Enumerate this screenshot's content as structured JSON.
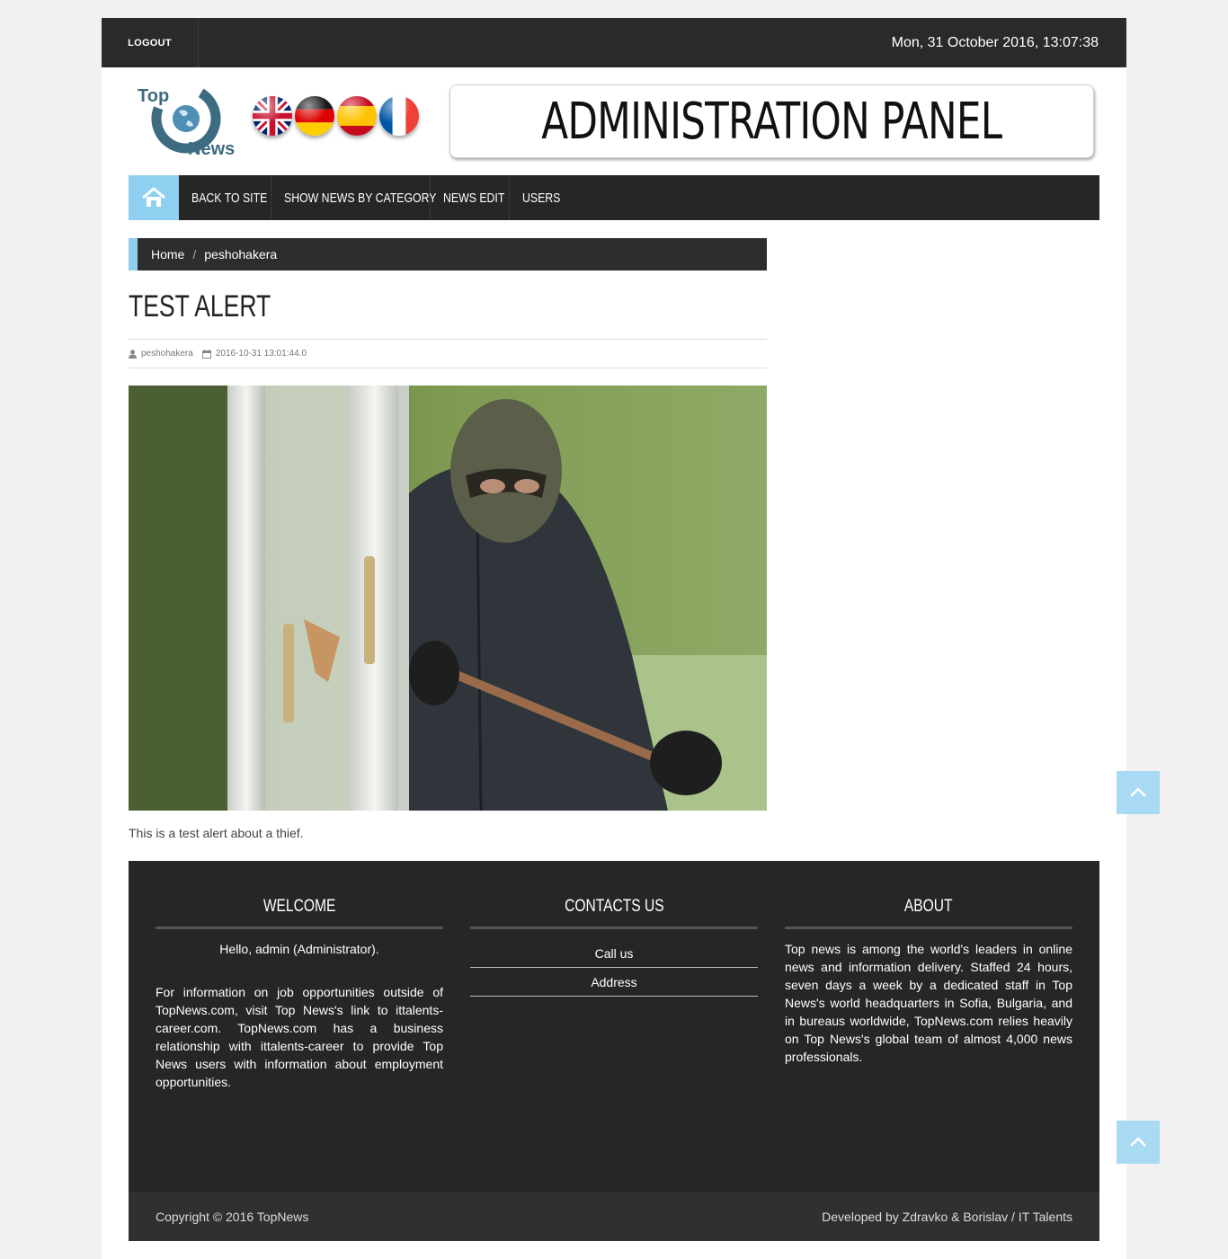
{
  "topbar": {
    "logout_label": "LOGOUT",
    "datetime": "Mon, 31 October 2016, 13:07:38"
  },
  "header": {
    "logo_text_top": "Top",
    "logo_text_bottom": "News",
    "flags": [
      "uk-flag",
      "germany-flag",
      "spain-flag",
      "france-flag"
    ],
    "banner_text": "ADMINISTRATION PANEL"
  },
  "nav": {
    "home_icon": "home-icon",
    "items": [
      {
        "label": "BACK TO SITE"
      },
      {
        "label": "SHOW NEWS BY CATEGORY"
      },
      {
        "label": "NEWS EDIT"
      },
      {
        "label": "USERS"
      }
    ]
  },
  "breadcrumb": {
    "home": "Home",
    "separator": "/",
    "current": "peshohakera"
  },
  "article": {
    "title": "TEST ALERT",
    "author": "peshohakera",
    "date": "2016-10-31 13:01:44.0",
    "body": "This is a test alert about a thief."
  },
  "footer": {
    "welcome": {
      "heading": "WELCOME",
      "greeting": "Hello, admin (Administrator).",
      "text": "For information on job opportunities outside of TopNews.com, visit Top News's link to ittalents-career.com. TopNews.com has a business relationship with ittalents-career to provide Top News users with information about employment opportunities."
    },
    "contacts": {
      "heading": "CONTACTS US",
      "links": [
        "Call us",
        "Address"
      ]
    },
    "about": {
      "heading": "ABOUT",
      "text": "Top news is among the world's leaders in online news and information delivery. Staffed 24 hours, seven days a week by a dedicated staff in Top News's world headquarters in Sofia, Bulgaria, and in bureaus worldwide, TopNews.com relies heavily on Top News's global team of almost 4,000 news professionals."
    },
    "copyright": "Copyright © 2016 TopNews",
    "developed_by": "Developed by Zdravko & Borislav / IT Talents"
  },
  "colors": {
    "accent": "#8fd0f0",
    "dark": "#262626",
    "scroll_button": "#a9daf3"
  }
}
